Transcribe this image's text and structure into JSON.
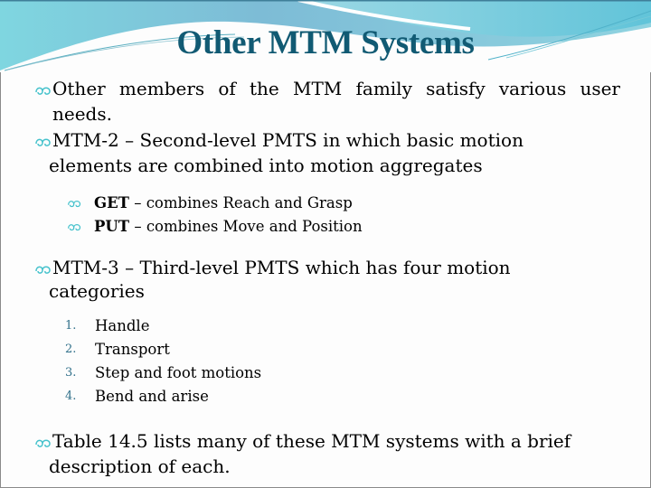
{
  "slide": {
    "title": "Other MTM Systems",
    "colors": {
      "title": "#115a73",
      "bullet_icon": "#45c2cc",
      "number": "#31708a",
      "text": "#000000",
      "header_wave_dark": "#6fb8cf",
      "header_wave_light": "#9fdbe6"
    },
    "bullets": [
      {
        "icon": "swirl-bullet-icon",
        "text": "Other members of the MTM family satisfy various user needs."
      },
      {
        "icon": "swirl-bullet-icon",
        "line1": "MTM-2 – Second-level PMTS in which basic motion",
        "line2": "elements are combined into motion aggregates",
        "sub_items": [
          {
            "icon": "swirl-bullet-icon",
            "bold": "GET",
            "text": " – combines Reach and Grasp"
          },
          {
            "icon": "swirl-bullet-icon",
            "bold": "PUT",
            "text": " – combines Move and Position"
          }
        ]
      },
      {
        "icon": "swirl-bullet-icon",
        "line1": "MTM-3 – Third-level PMTS which has four motion",
        "line2": "categories",
        "numbered_items": [
          {
            "number": "1.",
            "text": "Handle"
          },
          {
            "number": "2.",
            "text": "Transport"
          },
          {
            "number": "3.",
            "text": "Step and foot motions"
          },
          {
            "number": "4.",
            "text": "Bend and arise"
          }
        ]
      },
      {
        "icon": "swirl-bullet-icon",
        "line1": "Table 14.5 lists many of these MTM systems with a brief",
        "line2": "description of each."
      }
    ]
  }
}
